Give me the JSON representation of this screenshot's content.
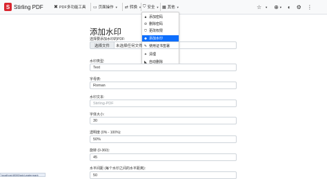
{
  "nav": {
    "brand": "Stirling PDF",
    "items": [
      {
        "label": "PDF多功能工具"
      },
      {
        "label": "页面操作"
      },
      {
        "label": "转换"
      },
      {
        "label": "安全"
      },
      {
        "label": "其他"
      }
    ]
  },
  "dropdown": {
    "items": [
      {
        "label": "添加密码"
      },
      {
        "label": "删除密码"
      },
      {
        "label": "更改权限"
      },
      {
        "label": "添加水印"
      },
      {
        "label": "使用证书签署"
      },
      {
        "label": "清理"
      },
      {
        "label": "自动删除"
      }
    ]
  },
  "page": {
    "title": "添加水印",
    "file_label": "选择要添加水印的PDF:",
    "file_button": "选择文件",
    "file_name": "未选择任何文件",
    "type_label": "水印类型:",
    "type_value": "Text",
    "font_label": "字母表:",
    "font_value": "Roman",
    "text_label": "水印文本:",
    "text_placeholder": "Stirling-PDF",
    "size_label": "字体大小:",
    "size_value": "30",
    "opacity_label": "透明度 (0% - 100%):",
    "opacity_value": "50%",
    "rotation_label": "旋转 (0-360):",
    "rotation_value": "45",
    "hspace_label": "水平间距 (每个水印之间的水平距离):",
    "hspace_value": "50"
  },
  "status": {
    "url": "localhost:8080/add-watermark"
  }
}
